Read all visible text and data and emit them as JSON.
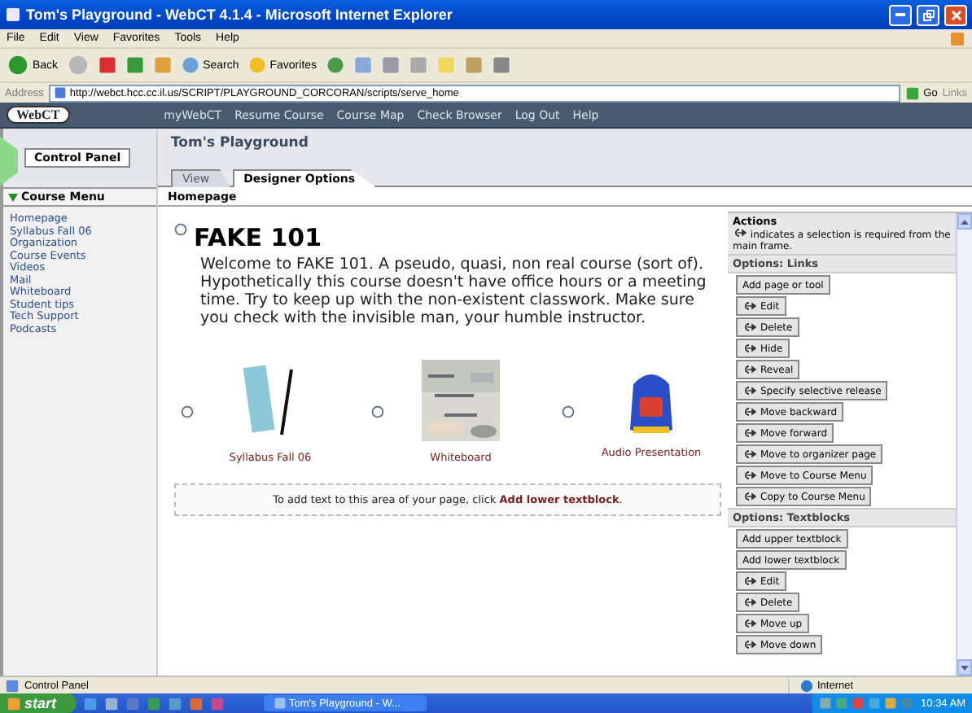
{
  "window": {
    "title": "Tom's Playground - WebCT 4.1.4 - Microsoft Internet Explorer"
  },
  "menu": [
    "File",
    "Edit",
    "View",
    "Favorites",
    "Tools",
    "Help"
  ],
  "toolbar": {
    "back": "Back",
    "search": "Search",
    "favorites": "Favorites"
  },
  "address": {
    "label": "Address",
    "value": "http://webct.hcc.cc.il.us/SCRIPT/PLAYGROUND_CORCORAN/scripts/serve_home",
    "go": "Go",
    "links": "Links"
  },
  "webct": {
    "logo": "WebCT",
    "nav": [
      "myWebCT",
      "Resume Course",
      "Course Map",
      "Check Browser",
      "Log Out",
      "Help"
    ]
  },
  "control_panel": "Control Panel",
  "course": {
    "title": "Tom's Playground",
    "tabs": [
      {
        "label": "View",
        "selected": false
      },
      {
        "label": "Designer Options",
        "selected": true
      }
    ]
  },
  "course_menu": {
    "heading": "Course Menu",
    "items": [
      "Homepage",
      "Syllabus Fall 06",
      "Organization",
      "Course Events",
      "Videos",
      "Mail",
      "Whiteboard",
      "Student tips",
      "Tech Support",
      "Podcasts"
    ]
  },
  "breadcrumb": "Homepage",
  "content": {
    "heading": "FAKE 101",
    "welcome": "Welcome to FAKE 101. A pseudo, quasi, non real course (sort of). Hypothetically this course doesn't have office hours or a meeting time. Try to keep up with the non-existent classwork. Make sure you check with the invisible man, your humble instructor.",
    "items": [
      {
        "label": "Syllabus Fall 06",
        "kind": "booklet"
      },
      {
        "label": "Whiteboard",
        "kind": "picture"
      },
      {
        "label": "Audio Presentation",
        "kind": "backpack"
      }
    ],
    "note": "To add text to this area of your page, click",
    "note_link": "Add lower textblock",
    "note_end": "."
  },
  "actions": {
    "title": "Actions",
    "hint": "indicates a selection is required from the main frame.",
    "sections": [
      {
        "heading": "Options: Links",
        "buttons": [
          {
            "label": "Add page or tool",
            "needs_selection": false
          },
          {
            "label": "Edit",
            "needs_selection": true
          },
          {
            "label": "Delete",
            "needs_selection": true
          },
          {
            "label": "Hide",
            "needs_selection": true
          },
          {
            "label": "Reveal",
            "needs_selection": true
          },
          {
            "label": "Specify selective release",
            "needs_selection": true
          },
          {
            "label": "Move backward",
            "needs_selection": true
          },
          {
            "label": "Move forward",
            "needs_selection": true
          },
          {
            "label": "Move to organizer page",
            "needs_selection": true
          },
          {
            "label": "Move to Course Menu",
            "needs_selection": true
          },
          {
            "label": "Copy to Course Menu",
            "needs_selection": true
          }
        ]
      },
      {
        "heading": "Options: Textblocks",
        "buttons": [
          {
            "label": "Add upper textblock",
            "needs_selection": false
          },
          {
            "label": "Add lower textblock",
            "needs_selection": false
          },
          {
            "label": "Edit",
            "needs_selection": true
          },
          {
            "label": "Delete",
            "needs_selection": true
          },
          {
            "label": "Move up",
            "needs_selection": true
          },
          {
            "label": "Move down",
            "needs_selection": true
          }
        ]
      }
    ]
  },
  "status": {
    "text": "Control Panel",
    "zone": "Internet"
  },
  "taskbar": {
    "start": "start",
    "task": "Tom's Playground - W...",
    "clock": "10:34 AM"
  }
}
